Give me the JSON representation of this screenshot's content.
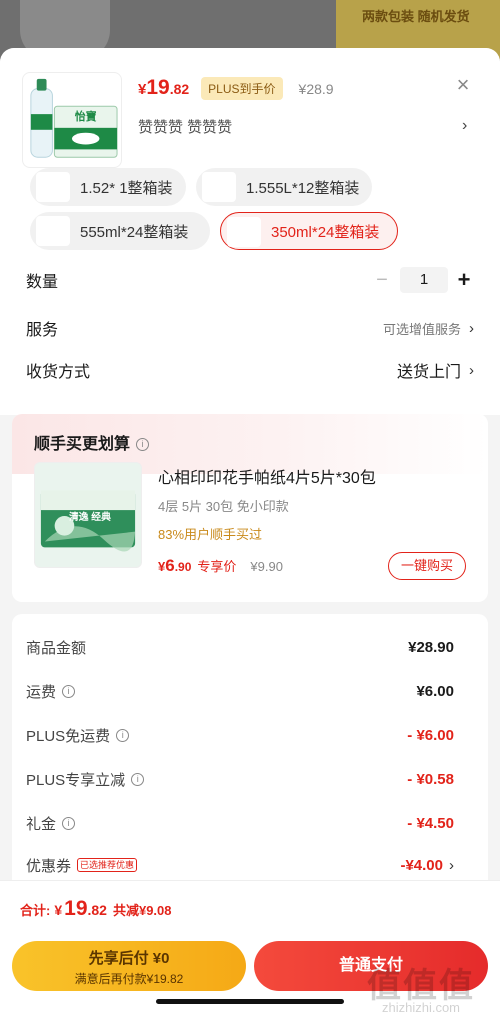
{
  "background_ad": {
    "text": "两款包装 随机发货"
  },
  "product": {
    "price_currency": "¥",
    "price_int": "19",
    "price_dec": ".82",
    "plus_badge": "PLUS到手价",
    "original_price": "¥28.9",
    "spec_label": "赞赞赞  赞赞赞",
    "thumb_brand": "怡寶"
  },
  "options": {
    "partial_left": "1.52* 1整箱装",
    "partial_right": "1.555L*12整箱装",
    "chip_1": "555ml*24整箱装",
    "chip_2": "350ml*24整箱装",
    "selected": "350ml*24整箱装"
  },
  "quantity": {
    "label": "数量",
    "value": "1",
    "minus": "−",
    "plus": "+"
  },
  "service": {
    "label": "服务",
    "value": "可选增值服务"
  },
  "delivery": {
    "label": "收货方式",
    "value": "送货上门"
  },
  "upsell": {
    "title": "顺手买更划算",
    "name": "心相印印花手帕纸4片5片*30包",
    "spec": "4层 5片 30包 免小印款",
    "note": "83%用户顺手买过",
    "price_cur": "¥",
    "price_int": "6",
    "price_dec": ".90",
    "price_tag": "专享价",
    "old_price": "¥9.90",
    "buy_button": "一键购买",
    "image_text": "清逸 经典"
  },
  "summary": {
    "rows": [
      {
        "label": "商品金额",
        "value": "¥28.90"
      },
      {
        "label": "运费",
        "value": "¥6.00"
      },
      {
        "label": "PLUS免运费",
        "value": "- ¥6.00"
      },
      {
        "label": "PLUS专享立减",
        "value": "- ¥0.58"
      },
      {
        "label": "礼金",
        "value": "- ¥4.50"
      },
      {
        "label": "优惠券",
        "value": "-¥4.00",
        "tag": "已选推荐优惠"
      }
    ]
  },
  "footer": {
    "total_label": "合计:",
    "total_cur": "¥",
    "total_int": "19",
    "total_dec": ".82",
    "total_reduction": "共减¥9.08",
    "pay_later_line1": "先享后付 ¥0",
    "pay_later_line2": "满意后再付款¥19.82",
    "normal_pay": "普通支付",
    "watermark_big": "值值值",
    "watermark_small": "zhizhizhi.com"
  },
  "colors": {
    "accent_red": "#e2231a",
    "plus_gold": "#fbe9b8",
    "pay_later_yellow": "#f9c32a"
  }
}
